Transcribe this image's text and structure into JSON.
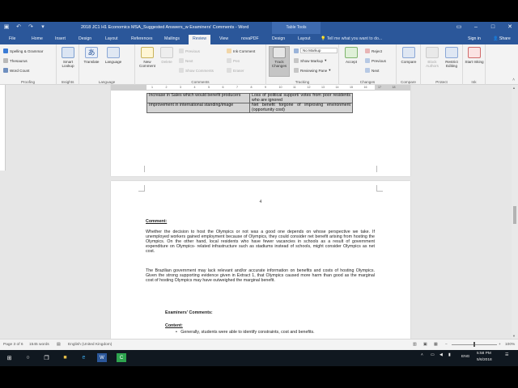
{
  "titlebar": {
    "doc_title": "2018 JC1 H1 Economics MSA_Suggested Answers_w Examiners' Comments - Word",
    "context_title": "Table Tools",
    "qat": [
      "save",
      "undo",
      "redo",
      "customize"
    ]
  },
  "tabs": {
    "items": [
      "File",
      "Home",
      "Insert",
      "Design",
      "Layout",
      "References",
      "Mailings",
      "Review",
      "View",
      "novaPDF",
      "Design",
      "Layout"
    ],
    "active": "Review",
    "tell_me": "Tell me what you want to do...",
    "sign_in": "Sign in",
    "share": "Share"
  },
  "ribbon": {
    "proofing": {
      "label": "Proofing",
      "spelling": "Spelling & Grammar",
      "thesaurus": "Thesaurus",
      "word_count": "Word Count"
    },
    "insights": {
      "label": "Insights",
      "smart_lookup": "Smart Lookup"
    },
    "language": {
      "label": "Language",
      "translate": "Translate",
      "language": "Language"
    },
    "comments": {
      "label": "Comments",
      "new_comment": "New Comment",
      "delete": "Delete",
      "previous": "Previous",
      "next": "Next",
      "show_comments": "Show Comments",
      "ink_comment": "Ink Comment",
      "pen": "Pen",
      "eraser": "Eraser"
    },
    "tracking": {
      "label": "Tracking",
      "track_changes": "Track Changes",
      "markup": "No Markup",
      "show_markup": "Show Markup",
      "reviewing_pane": "Reviewing Pane"
    },
    "changes": {
      "label": "Changes",
      "accept": "Accept",
      "reject": "Reject",
      "previous": "Previous",
      "next": "Next"
    },
    "compare": {
      "label": "Compare",
      "compare": "Compare"
    },
    "protect": {
      "label": "Protect",
      "block_authors": "Block Authors",
      "restrict_editing": "Restrict Editing"
    },
    "ink": {
      "label": "Ink",
      "start_inking": "Start Inking"
    }
  },
  "ruler": {
    "numbers": [
      "1",
      "2",
      "3",
      "4",
      "5",
      "6",
      "7",
      "8",
      "9",
      "10",
      "11",
      "12",
      "13",
      "14",
      "15",
      "16",
      "17",
      "18"
    ]
  },
  "page1": {
    "table_rows": [
      [
        "Increase in Sales which would benefit producers",
        "Loss of political support/ votes from poor residents who are ignored"
      ],
      [
        "Improvement in international standing/image",
        "Net benefit forgone of improving environment (opportunity cost)"
      ]
    ]
  },
  "page2": {
    "page_number": "4",
    "comment_heading": "Comment:",
    "paragraph1": "Whether the decision to host the Olympics or not was a good one depends on whose perspective we take. If unemployed workers gained employment because of Olympics, they could consider net benefit arising from hosting the Olympics. On the other hand, local residents who have fewer vacancies in schools as a result of government expenditure on Olympics- related infrastructure such as stadiums instead of schools, might consider Olympics as net cost.",
    "paragraph2": "The Brazilian government may lack relevant and/or accurate information on benefits and costs of hosting Olympics. Given the strong supporting evidence given in Extract 1, that Olympics caused more harm than good as the marginal cost of hosting Olympics may have outweighed the marginal benefit.",
    "examiners_heading": "Examiners' Comments:",
    "content_heading": "Content:",
    "bullet1": "Generally, students were able to identify constraints, cost and benefits."
  },
  "statusbar": {
    "page": "Page 3 of 6",
    "words": "1545 words",
    "language": "English (United Kingdom)",
    "zoom": "100%"
  },
  "taskbar": {
    "time": "5:58 PM",
    "date": "5/6/2018",
    "lang": "ENG"
  },
  "colors": {
    "word_blue": "#2b579a",
    "ribbon_bg": "#f3f3f3",
    "doc_bg": "#e6e6e6",
    "taskbar": "#101820"
  }
}
